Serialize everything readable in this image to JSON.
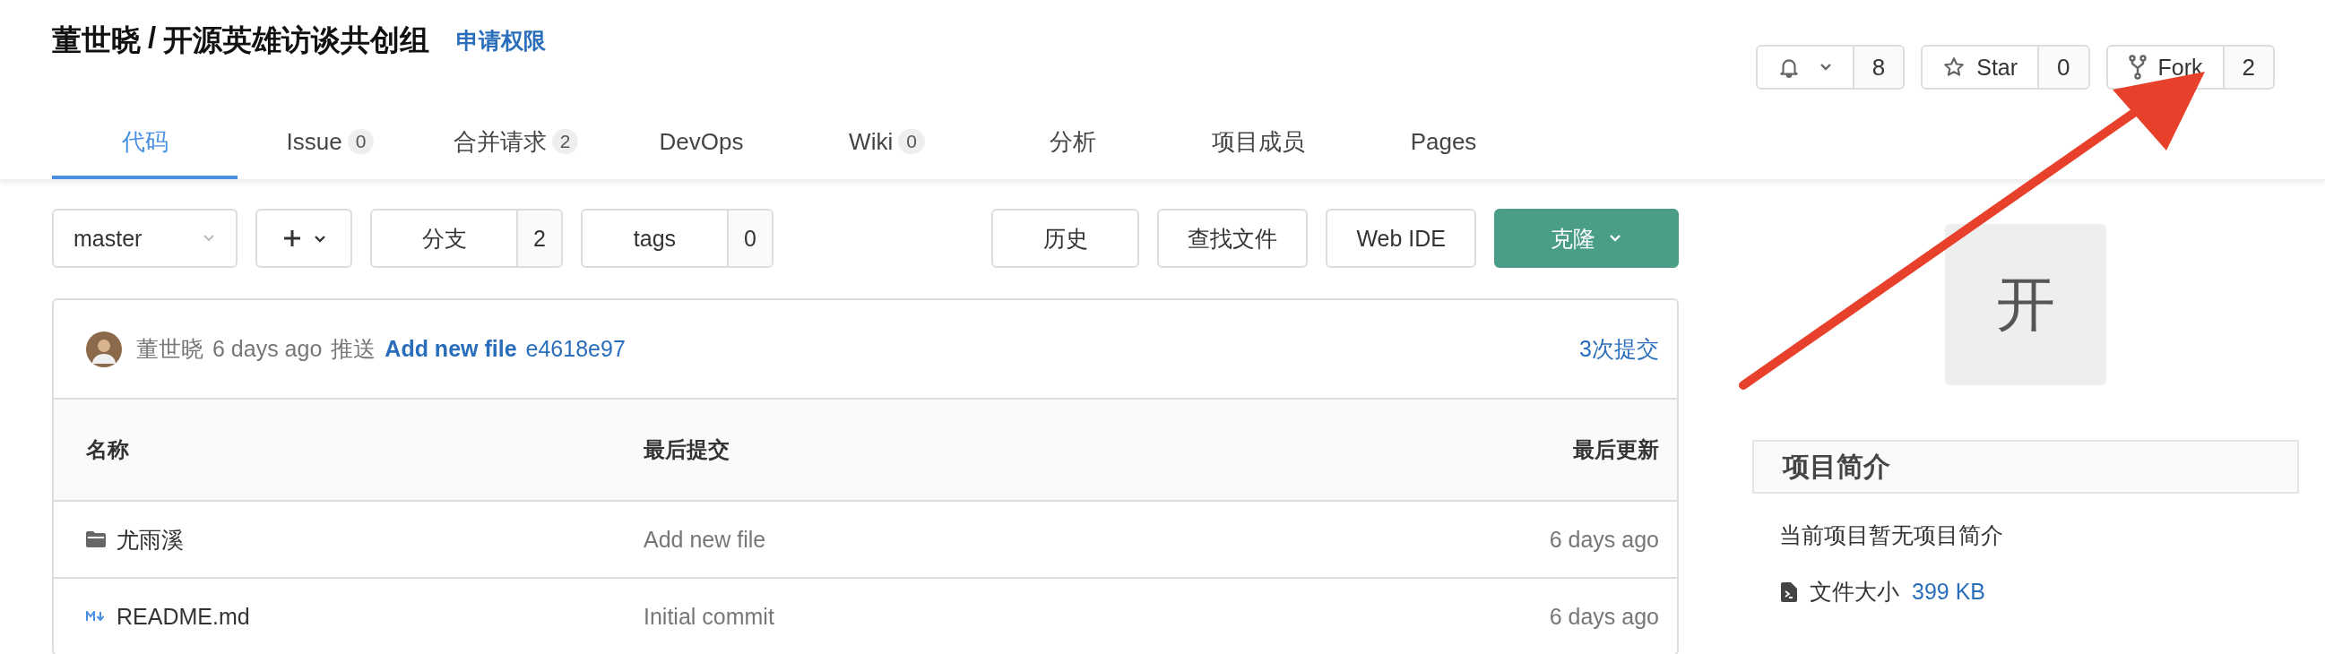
{
  "header": {
    "owner": "董世晓",
    "separator": "/",
    "project": "开源英雄访谈共创组",
    "request_access": "申请权限"
  },
  "actions": [
    {
      "kind": "watch",
      "count": "8"
    },
    {
      "kind": "star",
      "label": "Star",
      "count": "0"
    },
    {
      "kind": "fork",
      "label": "Fork",
      "count": "2"
    }
  ],
  "tabs": [
    {
      "label": "代码",
      "selected": true
    },
    {
      "label": "Issue",
      "count": "0",
      "selected": false
    },
    {
      "label": "合并请求",
      "count": "2",
      "selected": false
    },
    {
      "label": "DevOps",
      "selected": false
    },
    {
      "label": "Wiki",
      "count": "0",
      "selected": false
    },
    {
      "label": "分析",
      "selected": false
    },
    {
      "label": "项目成员",
      "selected": false
    },
    {
      "label": "Pages",
      "selected": false
    }
  ],
  "toolbar": {
    "branch": "master",
    "branches": {
      "label": "分支",
      "count": "2"
    },
    "tags": {
      "label": "tags",
      "count": "0"
    },
    "buttons": [
      "历史",
      "查找文件",
      "Web IDE"
    ],
    "clone": "克隆"
  },
  "last_commit": {
    "author": "董世晓",
    "time": "6 days ago",
    "action": "推送",
    "message": "Add new file",
    "sha": "e4618e97",
    "commit_count": "3次提交"
  },
  "table": {
    "columns": [
      "名称",
      "最后提交",
      "最后更新"
    ],
    "rows": [
      {
        "kind": "folder",
        "name": "尤雨溪",
        "commit": "Add new file",
        "updated": "6 days ago"
      },
      {
        "kind": "markdown",
        "name": "README.md",
        "commit": "Initial commit",
        "updated": "6 days ago"
      }
    ]
  },
  "sidebar": {
    "avatar_letter": "开",
    "about_title": "项目简介",
    "description": "当前项目暂无项目简介",
    "file_size_label": "文件大小",
    "file_size": "399 KB"
  }
}
